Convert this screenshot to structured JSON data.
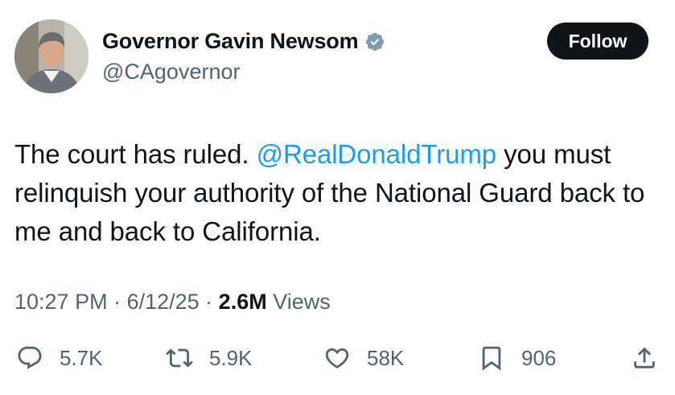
{
  "author": {
    "display_name": "Governor Gavin Newsom",
    "handle": "@CAgovernor",
    "verified_icon": "verified-badge-icon",
    "verified_color": "#829aab"
  },
  "follow_button": {
    "label": "Follow"
  },
  "tweet": {
    "text_before": "The court has ruled. ",
    "mention": "@RealDonaldTrump",
    "text_after": " you must relinquish your authority of the National Guard back to me and back to California."
  },
  "meta": {
    "time": "10:27 PM",
    "sep1": " · ",
    "date": "6/12/25",
    "sep2": " · ",
    "views_count": "2.6M",
    "views_label": " Views"
  },
  "actions": {
    "replies": {
      "icon": "reply-icon",
      "count": "5.7K"
    },
    "reposts": {
      "icon": "repost-icon",
      "count": "5.9K"
    },
    "likes": {
      "icon": "heart-icon",
      "count": "58K"
    },
    "bookmarks": {
      "icon": "bookmark-icon",
      "count": "906"
    },
    "share": {
      "icon": "share-icon"
    }
  },
  "colors": {
    "text": "#0f1419",
    "secondary": "#536471",
    "link": "#1d9bf0",
    "button_bg": "#0f1419",
    "button_text": "#ffffff"
  }
}
